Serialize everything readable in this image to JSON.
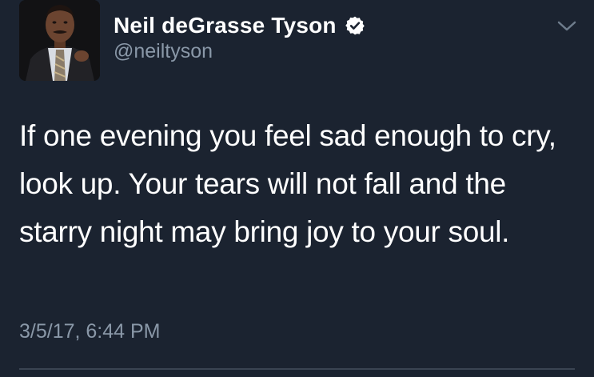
{
  "author": {
    "display_name": "Neil deGrasse Tyson",
    "handle": "@neiltyson",
    "verified": true,
    "avatar": "profile-photo"
  },
  "tweet": {
    "text": "If one evening you feel sad enough to cry, look up. Your tears will not fall and the starry night may bring joy to your soul.",
    "timestamp": "3/5/17, 6:44 PM"
  },
  "icons": {
    "verified": "verified-badge-icon",
    "menu": "chevron-down-icon"
  },
  "colors": {
    "background": "#1b2330",
    "primary_text": "#ffffff",
    "secondary_text": "#8a98a8",
    "divider": "#3a4452"
  }
}
